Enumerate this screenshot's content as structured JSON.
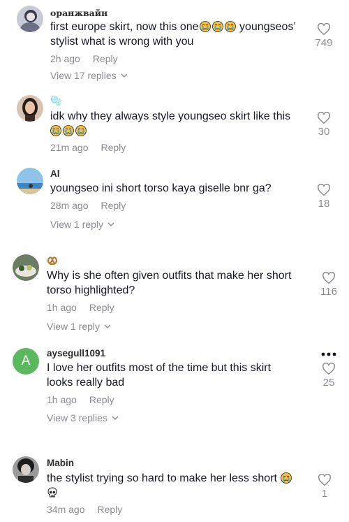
{
  "comments": [
    {
      "username": "оранжвайн",
      "lines": [
        "first europe skirt, now this one",
        " youngseos’",
        "stylist what is wrong with you"
      ],
      "emojis_line1": [
        "crying-emoji",
        "crying-emoji",
        "crying-emoji"
      ],
      "time": "2h ago",
      "reply_label": "Reply",
      "likes": "749",
      "view_replies": "View 17 replies"
    },
    {
      "username": "🫧",
      "lines": [
        "idk why they always style youngseo skirt like this"
      ],
      "emojis_line2": [
        "crying-emoji",
        "crying-emoji",
        "crying-emoji"
      ],
      "time": "21m ago",
      "reply_label": "Reply",
      "likes": "30"
    },
    {
      "username": "Al",
      "lines": [
        "youngseo ini short torso kaya giselle bnr ga?"
      ],
      "time": "28m ago",
      "reply_label": "Reply",
      "likes": "18",
      "view_replies": "View 1 reply"
    },
    {
      "username_emoji": "pretzel-emoji",
      "lines": [
        "Why is she often given outfits that make her short",
        "torso highlighted?"
      ],
      "time": "1h ago",
      "reply_label": "Reply",
      "likes": "116",
      "view_replies": "View 1 reply"
    },
    {
      "avatar_letter": "A",
      "username": "aysegull1091",
      "lines": [
        "I love her outfits most of the time but this skirt",
        "looks really bad"
      ],
      "time": "1h ago",
      "reply_label": "Reply",
      "likes": "25",
      "view_replies": "View 3 replies"
    },
    {
      "username": "Mabin",
      "lines": [
        "the stylist trying so hard to make her less short"
      ],
      "emojis": [
        "crying-emoji",
        "skull-emoji"
      ],
      "time": "34m ago",
      "reply_label": "Reply",
      "likes": "1"
    }
  ],
  "colors": {
    "secondary_text": "#8a8b91",
    "primary_text": "#161823",
    "letter_avatar": "#5cb85c"
  }
}
